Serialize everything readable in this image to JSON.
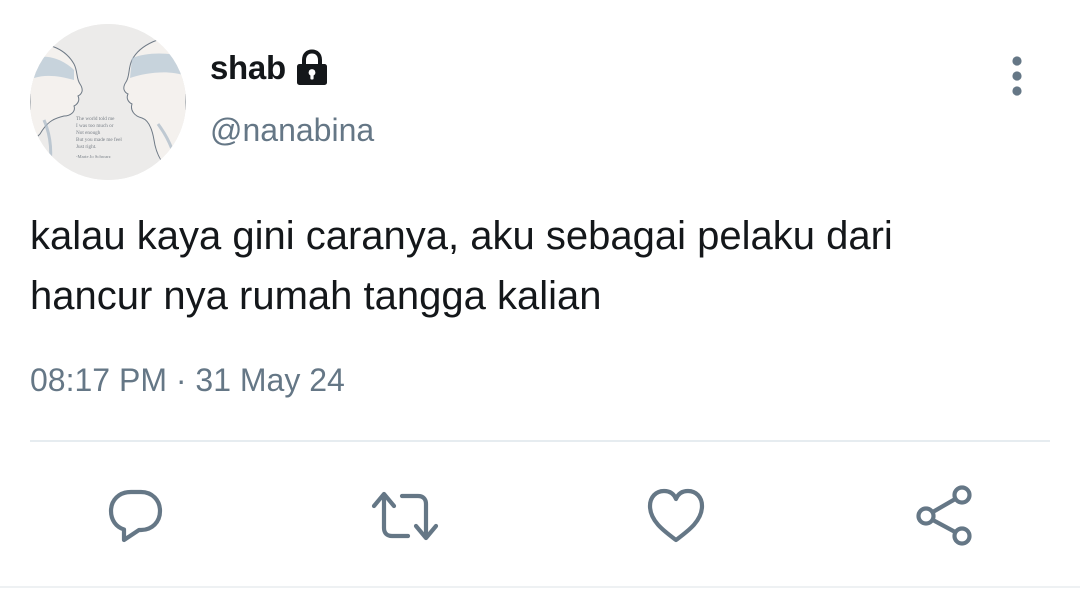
{
  "user": {
    "display_name": "shab",
    "handle": "@nanabina",
    "protected_icon": "lock-icon",
    "avatar": {
      "quote_lines": [
        "The world told me",
        "I was too much or",
        "Not enough",
        "But you made me feel",
        "Just right."
      ],
      "quote_author": "-Marie Jo Schwarz"
    }
  },
  "menu": {
    "icon": "more-vertical-icon"
  },
  "tweet": {
    "text_lines": [
      "kalau kaya gini caranya, aku sebagai pelaku dari",
      "hancur nya rumah tangga kalian"
    ],
    "timestamp": "08:17 PM · 31 May 24"
  },
  "actions": {
    "reply_icon": "reply-icon",
    "retweet_icon": "retweet-icon",
    "like_icon": "heart-icon",
    "share_icon": "share-icon"
  },
  "colors": {
    "text": "#14171a",
    "secondary": "#657786",
    "divider": "#e6ecf0",
    "icon": "#657786"
  }
}
